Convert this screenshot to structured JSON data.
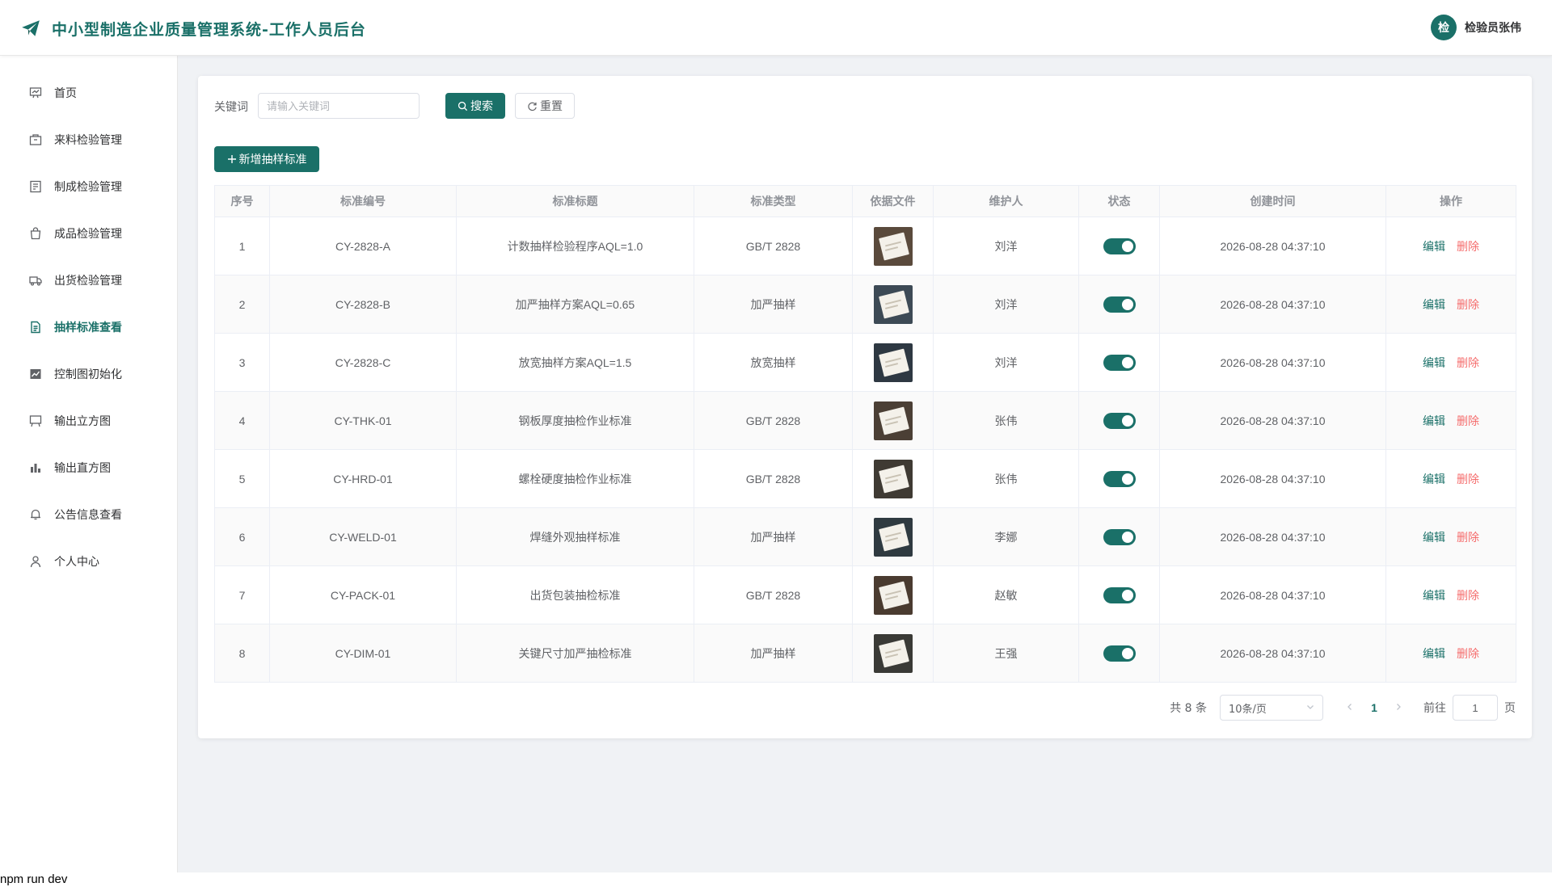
{
  "header": {
    "title": "中小型制造企业质量管理系统-工作人员后台",
    "avatar_text": "检",
    "user_name": "检验员张伟"
  },
  "sidebar": {
    "items": [
      {
        "label": "首页",
        "icon": "dashboard-icon",
        "active": false
      },
      {
        "label": "来料检验管理",
        "icon": "box-icon",
        "active": false
      },
      {
        "label": "制成检验管理",
        "icon": "checklist-icon",
        "active": false
      },
      {
        "label": "成品检验管理",
        "icon": "bag-icon",
        "active": false
      },
      {
        "label": "出货检验管理",
        "icon": "truck-icon",
        "active": false
      },
      {
        "label": "抽样标准查看",
        "icon": "document-icon",
        "active": true
      },
      {
        "label": "控制图初始化",
        "icon": "line-chart-icon",
        "active": false
      },
      {
        "label": "输出立方图",
        "icon": "board-icon",
        "active": false
      },
      {
        "label": "输出直方图",
        "icon": "bar-chart-icon",
        "active": false
      },
      {
        "label": "公告信息查看",
        "icon": "bell-icon",
        "active": false
      },
      {
        "label": "个人中心",
        "icon": "user-icon",
        "active": false
      }
    ]
  },
  "search": {
    "label": "关键词",
    "placeholder": "请输入关键词",
    "value": "",
    "search_label": "搜索",
    "reset_label": "重置"
  },
  "toolbar": {
    "add_label": "新增抽样标准"
  },
  "table": {
    "columns": [
      "序号",
      "标准编号",
      "标准标题",
      "标准类型",
      "依据文件",
      "维护人",
      "状态",
      "创建时间",
      "操作"
    ],
    "edit_label": "编辑",
    "delete_label": "删除",
    "rows": [
      {
        "index": "1",
        "code": "CY-2828-A",
        "title": "计数抽样检验程序AQL=1.0",
        "type": "GB/T 2828",
        "file": "document-photo",
        "maintainer": "刘洋",
        "status": true,
        "created": "2026-08-28 04:37:10"
      },
      {
        "index": "2",
        "code": "CY-2828-B",
        "title": "加严抽样方案AQL=0.65",
        "type": "加严抽样",
        "file": "document-photo",
        "maintainer": "刘洋",
        "status": true,
        "created": "2026-08-28 04:37:10"
      },
      {
        "index": "3",
        "code": "CY-2828-C",
        "title": "放宽抽样方案AQL=1.5",
        "type": "放宽抽样",
        "file": "document-photo",
        "maintainer": "刘洋",
        "status": true,
        "created": "2026-08-28 04:37:10"
      },
      {
        "index": "4",
        "code": "CY-THK-01",
        "title": "钢板厚度抽检作业标准",
        "type": "GB/T 2828",
        "file": "document-photo",
        "maintainer": "张伟",
        "status": true,
        "created": "2026-08-28 04:37:10"
      },
      {
        "index": "5",
        "code": "CY-HRD-01",
        "title": "螺栓硬度抽检作业标准",
        "type": "GB/T 2828",
        "file": "document-photo",
        "maintainer": "张伟",
        "status": true,
        "created": "2026-08-28 04:37:10"
      },
      {
        "index": "6",
        "code": "CY-WELD-01",
        "title": "焊缝外观抽样标准",
        "type": "加严抽样",
        "file": "document-photo",
        "maintainer": "李娜",
        "status": true,
        "created": "2026-08-28 04:37:10"
      },
      {
        "index": "7",
        "code": "CY-PACK-01",
        "title": "出货包装抽检标准",
        "type": "GB/T 2828",
        "file": "document-photo",
        "maintainer": "赵敏",
        "status": true,
        "created": "2026-08-28 04:37:10"
      },
      {
        "index": "8",
        "code": "CY-DIM-01",
        "title": "关键尺寸加严抽检标准",
        "type": "加严抽样",
        "file": "document-photo",
        "maintainer": "王强",
        "status": true,
        "created": "2026-08-28 04:37:10"
      }
    ]
  },
  "pagination": {
    "total_text": "共 8 条",
    "page_size": "10条/页",
    "current_page": "1",
    "goto_label": "前往",
    "goto_value": "1",
    "page_suffix": "页"
  },
  "terminal": {
    "text": "npm run dev"
  },
  "colors": {
    "primary": "#1a7068",
    "danger": "#f56c6c"
  }
}
